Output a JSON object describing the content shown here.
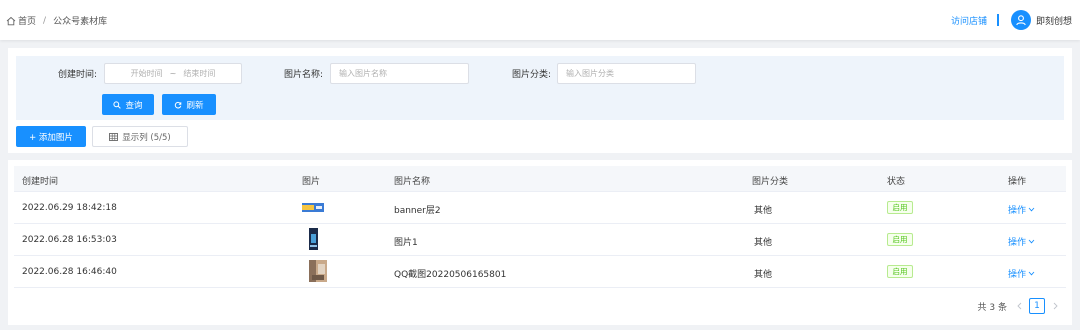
{
  "header": {
    "breadcrumb_home": "首页",
    "breadcrumb_separator": "/",
    "breadcrumb_current": "公众号素材库",
    "visit_store": "访问店铺",
    "user_name": "即刻创想"
  },
  "filters": {
    "created_time_label": "创建时间:",
    "start_placeholder": "开始时间",
    "range_separator": "~",
    "end_placeholder": "结束时间",
    "image_name_label": "图片名称:",
    "image_name_placeholder": "输入图片名称",
    "image_category_label": "图片分类:",
    "image_category_placeholder": "输入图片分类",
    "query_button": "查询",
    "refresh_button": "刷新"
  },
  "toolbar": {
    "add_image_button": "+ 添加图片",
    "show_columns_button": "显示列 (5/5)"
  },
  "table": {
    "columns": [
      "创建时间",
      "图片",
      "图片名称",
      "图片分类",
      "状态",
      "操作"
    ],
    "rows": [
      {
        "created": "2022.06.29 18:42:18",
        "thumb": "banner-thumbnail",
        "name": "banner层2",
        "category": "其他",
        "status": "启用",
        "action": "操作"
      },
      {
        "created": "2022.06.28 16:53:03",
        "thumb": "portrait-thumbnail",
        "name": "图片1",
        "category": "其他",
        "status": "启用",
        "action": "操作"
      },
      {
        "created": "2022.06.28 16:46:40",
        "thumb": "photo-thumbnail",
        "name": "QQ截图20220506165801",
        "category": "其他",
        "status": "启用",
        "action": "操作"
      }
    ]
  },
  "pagination": {
    "total_text": "共 3 条",
    "current_page": "1"
  },
  "colors": {
    "primary": "#1890ff",
    "success": "#52c41a",
    "filter_bg": "#eef4fb"
  },
  "icons": [
    "home-icon",
    "user-icon",
    "search-icon",
    "refresh-icon",
    "table-icon",
    "chevron-down-icon",
    "chevron-left-icon",
    "chevron-right-icon"
  ]
}
